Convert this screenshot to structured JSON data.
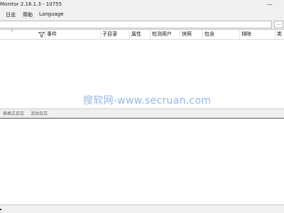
{
  "window": {
    "title": "Monitor 2.16.1.3 - 10755",
    "minimize_glyph": "—"
  },
  "menu": {
    "items": [
      {
        "label": "日志"
      },
      {
        "label": "帮助"
      },
      {
        "label": "Language"
      }
    ]
  },
  "filter": {
    "value": "",
    "button_label": "..."
  },
  "grid": {
    "columns": [
      {
        "label": ""
      },
      {
        "label": "事件"
      },
      {
        "label": "子目录"
      },
      {
        "label": "属性"
      },
      {
        "label": "检测用户"
      },
      {
        "label": "快照"
      },
      {
        "label": "包含"
      },
      {
        "label": "排除"
      },
      {
        "label": "类"
      }
    ],
    "sort_glyph": "^",
    "filter_icon": "funnel-icon",
    "rows": []
  },
  "watermark": {
    "text": "搜软网-www.secruan.com"
  },
  "log_tabs": {
    "items": [
      {
        "label": "表格式日志"
      },
      {
        "label": "活动日志"
      }
    ]
  },
  "colors": {
    "window_bg": "#f0f0f0",
    "pane_bg": "#ffffff",
    "watermark": "#6f9fe0"
  }
}
